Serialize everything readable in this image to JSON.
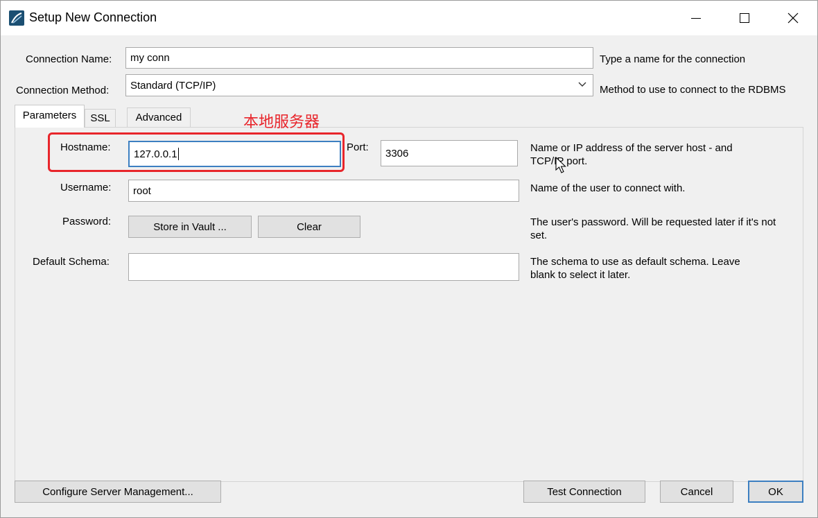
{
  "window": {
    "title": "Setup New Connection",
    "icon": "mysql-workbench-icon",
    "controls": [
      "minimize-icon",
      "maximize-icon",
      "close-icon"
    ]
  },
  "connection_name": {
    "label": "Connection Name:",
    "value": "my conn",
    "hint": "Type a name for the connection"
  },
  "connection_method": {
    "label": "Connection Method:",
    "value": "Standard (TCP/IP)",
    "hint": "Method to use to connect to the RDBMS"
  },
  "tabs": [
    {
      "label": "Parameters",
      "active": true
    },
    {
      "label": "SSL",
      "active": false
    },
    {
      "label": "Advanced",
      "active": false
    }
  ],
  "annotation": {
    "text": "本地服务器",
    "color": "#e8252b"
  },
  "parameters": {
    "hostname": {
      "label": "Hostname:",
      "value": "127.0.0.1"
    },
    "port": {
      "label": "Port:",
      "value": "3306"
    },
    "hostname_hint": "Name or IP address of the server host - and TCP/IP port.",
    "username": {
      "label": "Username:",
      "value": "root",
      "hint": "Name of the user to connect with."
    },
    "password": {
      "label": "Password:",
      "store_button": "Store in Vault ...",
      "clear_button": "Clear",
      "hint": "The user's password. Will be requested later if it's not set."
    },
    "default_schema": {
      "label": "Default Schema:",
      "value": "",
      "hint": "The schema to use as default schema. Leave blank to select it later."
    }
  },
  "footer": {
    "configure_button": "Configure Server Management...",
    "test_button": "Test Connection",
    "cancel_button": "Cancel",
    "ok_button": "OK"
  },
  "colors": {
    "focus_border": "#3c7fc1",
    "annotation": "#e8252b"
  }
}
